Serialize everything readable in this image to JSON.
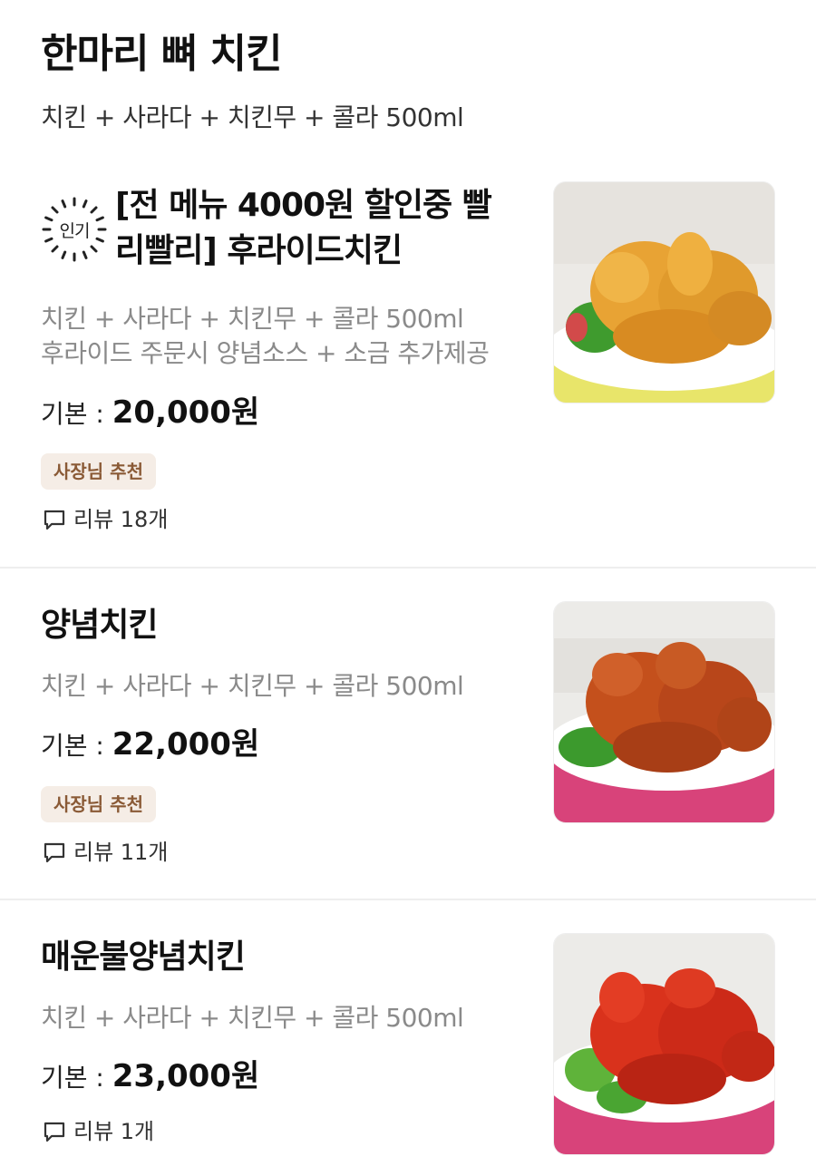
{
  "section": {
    "title": "한마리 뼈 치킨",
    "description": "치킨 + 사라다 + 치킨무 + 콜라 500ml"
  },
  "items": [
    {
      "popular_label": "인기",
      "title_line1": "[전 메뉴 4000원 할인중 빨",
      "title_line2": "리빨리] 후라이드치킨",
      "desc_line1": "치킨 + 사라다 + 치킨무 +  콜라 500ml",
      "desc_line2": "후라이드 주문시 양념소스 + 소금 추가제공",
      "price_label": "기본 : ",
      "price": "20,000원",
      "badge": "사장님 추천",
      "review": "리뷰 18개",
      "image_icon": "fried-chicken-photo"
    },
    {
      "title": "양념치킨",
      "desc": "치킨 + 사라다 + 치킨무 + 콜라 500ml",
      "price_label": "기본 : ",
      "price": "22,000원",
      "badge": "사장님 추천",
      "review": "리뷰 11개",
      "image_icon": "seasoned-chicken-photo"
    },
    {
      "title": "매운불양념치킨",
      "desc": "치킨 + 사라다 + 치킨무 + 콜라 500ml",
      "price_label": "기본 : ",
      "price": "23,000원",
      "review": "리뷰 1개",
      "image_icon": "spicy-chicken-photo"
    }
  ],
  "colors": {
    "badge_bg": "#f5ede6",
    "badge_text": "#8a5a36",
    "muted_text": "#8a8a8a"
  }
}
